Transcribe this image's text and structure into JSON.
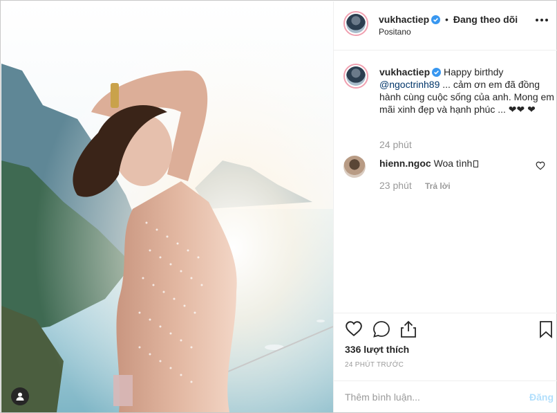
{
  "header": {
    "username": "vukhactiep",
    "separator": "•",
    "follow_status": "Đang theo dõi",
    "location": "Positano",
    "more_icon": "more-horizontal-icon"
  },
  "caption": {
    "username": "vukhactiep",
    "text_before": "Happy birthdy ",
    "mention": "@ngoctrinh89",
    "text_after": " ... cảm ơn em đã đồng hành cùng cuộc sống của anh. Mong em mãi xinh đẹp và hạnh phúc ... ❤❤ ❤",
    "time": "24 phút"
  },
  "comments": [
    {
      "username": "hienn.ngoc",
      "text": "Woa tình",
      "time": "23 phút",
      "reply_label": "Trả lời"
    }
  ],
  "actions": {
    "likes": "336 lượt thích",
    "post_time": "24 PHÚT TRƯỚC"
  },
  "add_comment": {
    "placeholder": "Thêm bình luận...",
    "post_label": "Đăng"
  },
  "colors": {
    "verified_blue": "#3897f0",
    "mention_blue": "#003569",
    "post_button_disabled": "#b2dffc",
    "muted_text": "#999999"
  }
}
